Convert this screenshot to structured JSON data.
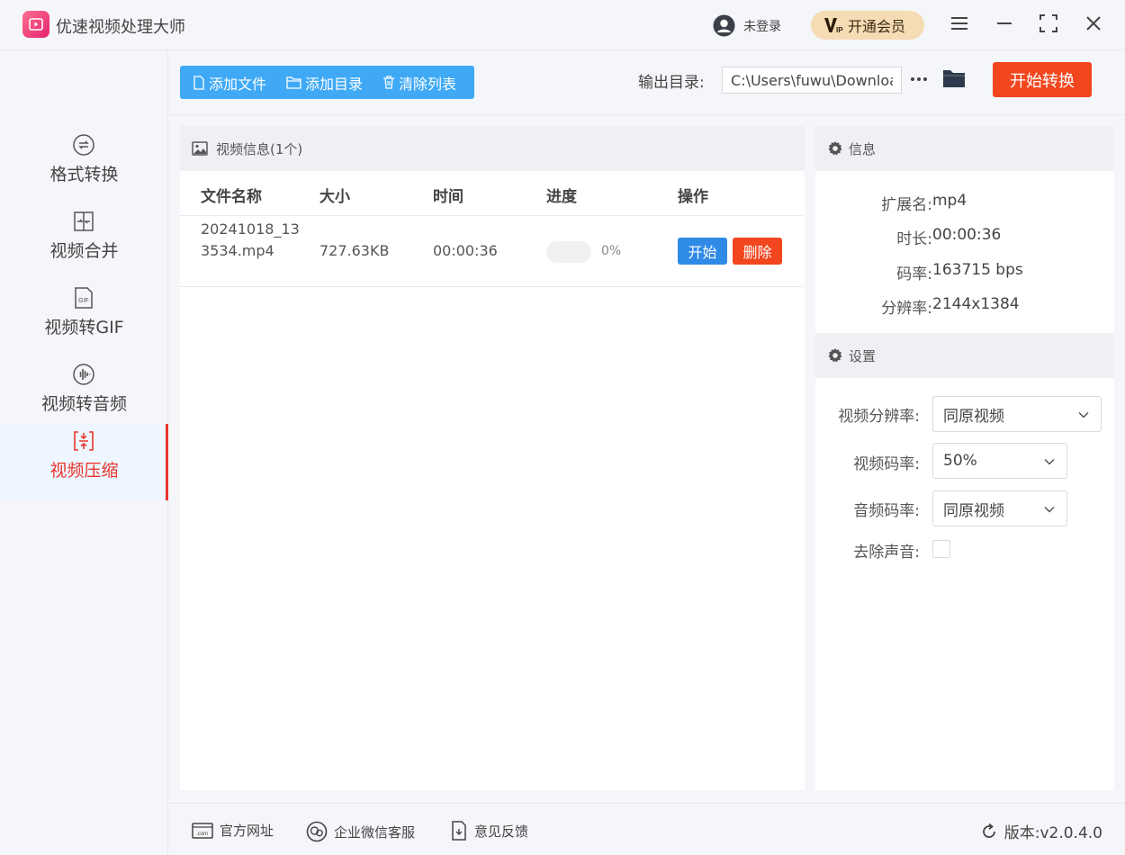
{
  "app": {
    "title": "优速视频处理大师"
  },
  "user": {
    "label": "未登录"
  },
  "vip": {
    "label": "开通会员"
  },
  "sidebar": {
    "items": [
      {
        "label": "格式转换",
        "icon": "format-convert-icon",
        "active": false
      },
      {
        "label": "视频合并",
        "icon": "video-merge-icon",
        "active": false
      },
      {
        "label": "视频转GIF",
        "icon": "gif-icon",
        "active": false
      },
      {
        "label": "视频转音频",
        "icon": "audio-icon",
        "active": false
      },
      {
        "label": "视频压缩",
        "icon": "compress-icon",
        "active": true
      }
    ]
  },
  "toolbar": {
    "add_file": "添加文件",
    "add_dir": "添加目录",
    "clear_list": "清除列表",
    "output_label": "输出目录:",
    "output_path": "C:\\Users\\fuwu\\Downloads",
    "start_convert": "开始转换"
  },
  "video_panel": {
    "title": "视频信息(1个)",
    "columns": [
      "文件名称",
      "大小",
      "时间",
      "进度",
      "操作"
    ],
    "rows": [
      {
        "name": "20241018_133534.mp4",
        "size": "727.63KB",
        "duration": "00:00:36",
        "progress": 0,
        "progress_label": "0%",
        "start": "开始",
        "delete": "删除"
      }
    ]
  },
  "info": {
    "title": "信息",
    "fields": [
      {
        "label": "扩展名:",
        "value": "mp4"
      },
      {
        "label": "时长:",
        "value": "00:00:36"
      },
      {
        "label": "码率:",
        "value": "163715 bps"
      },
      {
        "label": "分辨率:",
        "value": "2144x1384"
      }
    ]
  },
  "settings": {
    "title": "设置",
    "video_resolution_label": "视频分辨率:",
    "video_resolution_value": "同原视频",
    "video_bitrate_label": "视频码率:",
    "video_bitrate_value": "50%",
    "audio_bitrate_label": "音频码率:",
    "audio_bitrate_value": "同原视频",
    "remove_audio_label": "去除声音:",
    "remove_audio_checked": false
  },
  "footer": {
    "website": "官方网址",
    "wechat": "企业微信客服",
    "feedback": "意见反馈",
    "version": "版本:v2.0.4.0"
  },
  "colors": {
    "accent_blue": "#3fa9f5",
    "accent_red": "#f2461f",
    "active_red": "#e8352c",
    "vip_gold": "#f6dcb4"
  }
}
